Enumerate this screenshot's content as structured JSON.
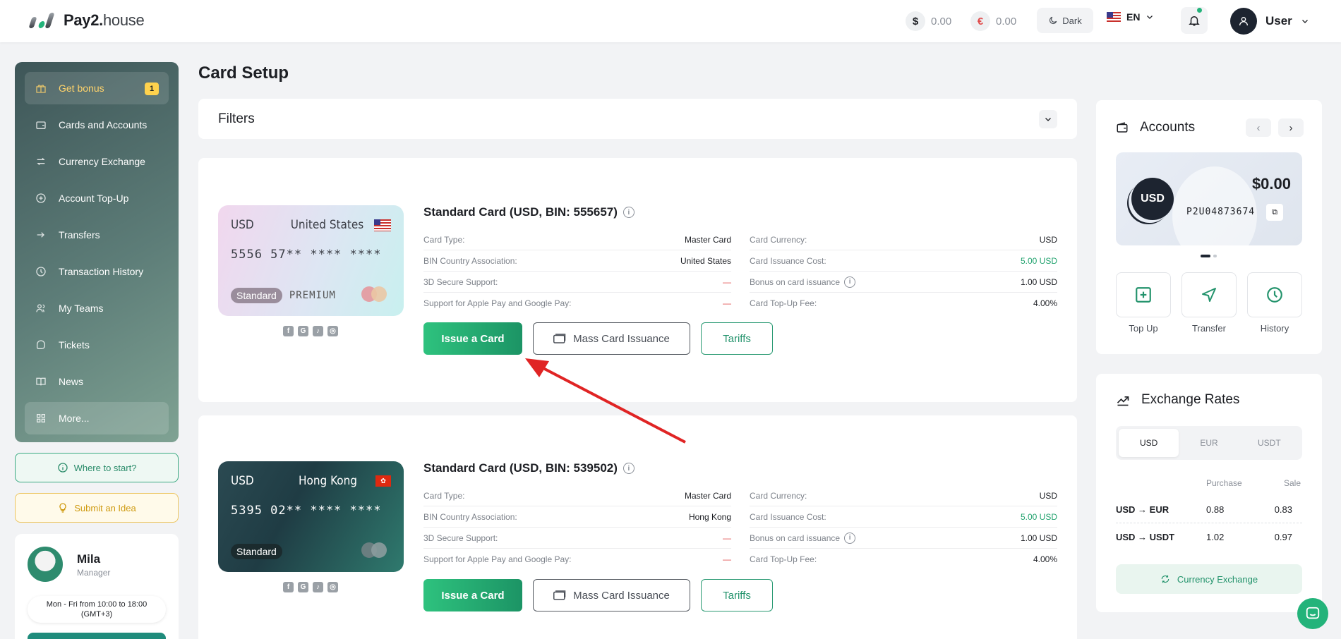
{
  "header": {
    "logo_bold": "Pay2.",
    "logo_rest": "house",
    "usd_symbol": "$",
    "usd_balance": "0.00",
    "eur_symbol": "€",
    "eur_balance": "0.00",
    "theme_label": "Dark",
    "language": "EN",
    "user_name": "User"
  },
  "sidebar": {
    "items": [
      {
        "label": "Get bonus",
        "icon": "gift-icon",
        "badge": "1"
      },
      {
        "label": "Cards and Accounts",
        "icon": "wallet-icon"
      },
      {
        "label": "Currency Exchange",
        "icon": "exchange-icon"
      },
      {
        "label": "Account Top-Up",
        "icon": "plus-circle-icon"
      },
      {
        "label": "Transfers",
        "icon": "arrow-right-icon"
      },
      {
        "label": "Transaction History",
        "icon": "clock-icon"
      },
      {
        "label": "My Teams",
        "icon": "users-icon"
      },
      {
        "label": "Tickets",
        "icon": "ticket-icon"
      },
      {
        "label": "News",
        "icon": "book-icon"
      },
      {
        "label": "More...",
        "icon": "grid-icon"
      }
    ],
    "where_to_start": "Where to start?",
    "submit_idea": "Submit an Idea",
    "manager": {
      "name": "Mila",
      "role": "Manager",
      "hours_line1": "Mon - Fri from 10:00 to 18:00",
      "hours_line2": "(GMT+3)"
    }
  },
  "main": {
    "title": "Card Setup",
    "filters_label": "Filters",
    "cards": [
      {
        "title": "Standard Card (USD, BIN: 555657)",
        "image": {
          "currency": "USD",
          "country": "United States",
          "number": "5556 57** **** ****",
          "tier": "Standard",
          "tier_extra": "PREMIUM"
        },
        "specs_left": [
          {
            "label": "Card Type:",
            "value": "Master Card"
          },
          {
            "label": "BIN Country Association:",
            "value": "United States"
          },
          {
            "label": "3D Secure Support:",
            "value": "—"
          },
          {
            "label": "Support for Apple Pay and Google Pay:",
            "value": "—"
          }
        ],
        "specs_right": [
          {
            "label": "Card Currency:",
            "value": "USD"
          },
          {
            "label": "Card Issuance Cost:",
            "value": "5.00 USD"
          },
          {
            "label": "Bonus on card issuance",
            "value": "1.00 USD"
          },
          {
            "label": "Card Top-Up Fee:",
            "value": "4.00%"
          }
        ],
        "issue_label": "Issue a Card",
        "mass_label": "Mass Card Issuance",
        "tariffs_label": "Tariffs"
      },
      {
        "title": "Standard Card (USD, BIN: 539502)",
        "image": {
          "currency": "USD",
          "country": "Hong Kong",
          "number": "5395 02** **** ****",
          "tier": "Standard",
          "tier_extra": ""
        },
        "specs_left": [
          {
            "label": "Card Type:",
            "value": "Master Card"
          },
          {
            "label": "BIN Country Association:",
            "value": "Hong Kong"
          },
          {
            "label": "3D Secure Support:",
            "value": "—"
          },
          {
            "label": "Support for Apple Pay and Google Pay:",
            "value": "—"
          }
        ],
        "specs_right": [
          {
            "label": "Card Currency:",
            "value": "USD"
          },
          {
            "label": "Card Issuance Cost:",
            "value": "5.00 USD"
          },
          {
            "label": "Bonus on card issuance",
            "value": "1.00 USD"
          },
          {
            "label": "Card Top-Up Fee:",
            "value": "4.00%"
          }
        ],
        "issue_label": "Issue a Card",
        "mass_label": "Mass Card Issuance",
        "tariffs_label": "Tariffs"
      }
    ]
  },
  "accounts": {
    "title": "Accounts",
    "currency": "USD",
    "amount": "$0.00",
    "account_id": "P2U04873674",
    "actions": [
      "Top Up",
      "Transfer",
      "History"
    ]
  },
  "rates": {
    "title": "Exchange Rates",
    "tabs": [
      "USD",
      "EUR",
      "USDT"
    ],
    "active_tab": "USD",
    "col_purchase": "Purchase",
    "col_sale": "Sale",
    "rows": [
      {
        "pair": "USD → EUR",
        "purchase": "0.88",
        "sale": "0.83"
      },
      {
        "pair": "USD → USDT",
        "purchase": "1.02",
        "sale": "0.97"
      }
    ],
    "exchange_button": "Currency Exchange"
  },
  "colors": {
    "accent": "#23b37a",
    "annotation_arrow": "#e02424"
  }
}
